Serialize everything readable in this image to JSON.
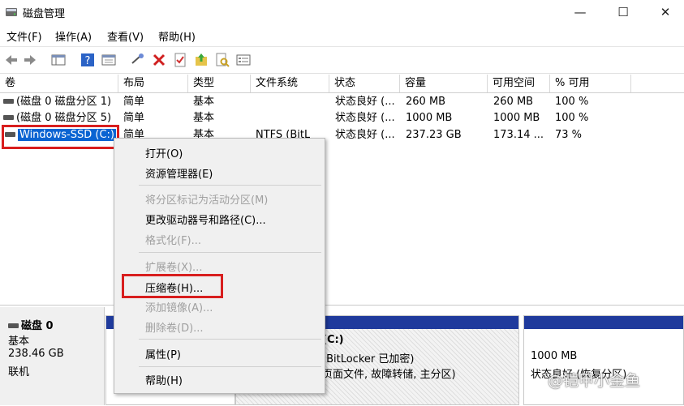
{
  "window": {
    "title": "磁盘管理"
  },
  "window_controls": {
    "minimize": "—",
    "maximize": "☐",
    "close": "✕"
  },
  "menu": [
    "文件(F)",
    "操作(A)",
    "查看(V)",
    "帮助(H)"
  ],
  "table": {
    "columns": [
      "卷",
      "布局",
      "类型",
      "文件系统",
      "状态",
      "容量",
      "可用空间",
      "% 可用"
    ],
    "rows": [
      [
        "(磁盘 0 磁盘分区 1)",
        "简单",
        "基本",
        "",
        "状态良好 (...",
        "260 MB",
        "260 MB",
        "100 %"
      ],
      [
        "(磁盘 0 磁盘分区 5)",
        "简单",
        "基本",
        "",
        "状态良好 (...",
        "1000 MB",
        "1000 MB",
        "100 %"
      ],
      [
        "Windows-SSD (C:)",
        "简单",
        "基本",
        "NTFS (BitL",
        "状态良好 (...",
        "237.23 GB",
        "173.14 ...",
        "73 %"
      ]
    ]
  },
  "context_menu": {
    "items": [
      {
        "label": "打开(O)",
        "enabled": true
      },
      {
        "label": "资源管理器(E)",
        "enabled": true
      },
      {
        "label": "将分区标记为活动分区(M)",
        "enabled": false
      },
      {
        "label": "更改驱动器号和路径(C)...",
        "enabled": true
      },
      {
        "label": "格式化(F)...",
        "enabled": false
      },
      {
        "label": "扩展卷(X)...",
        "enabled": false
      },
      {
        "label": "压缩卷(H)...",
        "enabled": true
      },
      {
        "label": "添加镜像(A)...",
        "enabled": false
      },
      {
        "label": "删除卷(D)...",
        "enabled": false
      },
      {
        "label": "属性(P)",
        "enabled": true
      },
      {
        "label": "帮助(H)",
        "enabled": true
      }
    ]
  },
  "disk": {
    "name": "磁盘 0",
    "type": "基本",
    "size": "238.46 GB",
    "status": "联机"
  },
  "partitions": {
    "c": {
      "label": "(C:)",
      "detail1": "(BitLocker 已加密)",
      "detail2": "页面文件, 故障转储, 主分区)"
    },
    "recovery": {
      "size": "1000 MB",
      "status": "状态良好 (恢复分区)"
    }
  },
  "watermark": "@铠甲小金鱼",
  "colors": {
    "selection": "#0a64d2",
    "highlight_box": "#d81e1e",
    "partition_bar": "#1f3a9c"
  }
}
